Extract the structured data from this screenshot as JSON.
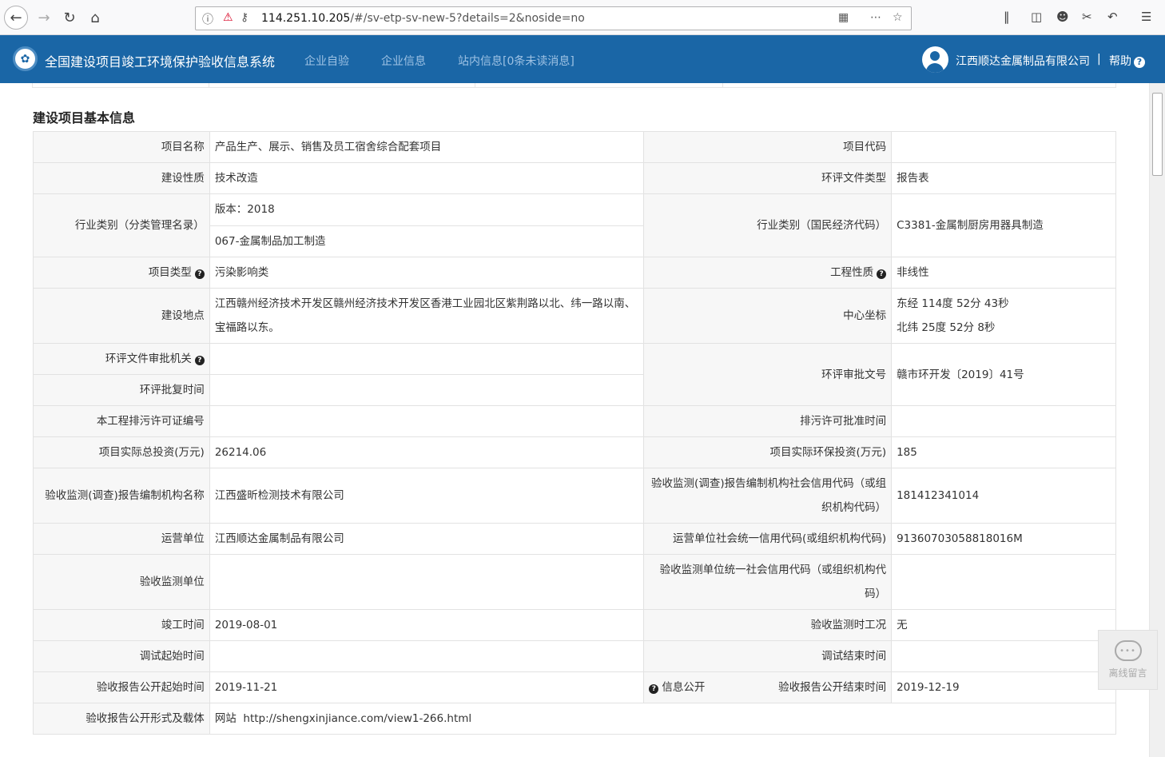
{
  "browser": {
    "url_host": "114.251.10.205",
    "url_path": "/#/sv-etp-sv-new-5?details=2&noside=no"
  },
  "header": {
    "title": "全国建设项目竣工环境保护验收信息系统",
    "nav": [
      "企业自验",
      "企业信息",
      "站内信息[0条未读消息]"
    ],
    "company": "江西顺达金属制品有限公司",
    "separator": "|",
    "help": "帮助",
    "help_icon": "?"
  },
  "section": {
    "title": "建设项目基本信息"
  },
  "rows": {
    "project_name_label": "项目名称",
    "project_name": "产品生产、展示、销售及员工宿舍综合配套项目",
    "project_code_label": "项目代码",
    "project_code": "",
    "nature_label": "建设性质",
    "nature": "技术改造",
    "eia_type_label": "环评文件类型",
    "eia_type": "报告表",
    "industry_cat_label": "行业类别（分类管理名录）",
    "industry_version": "版本：2018",
    "industry_cat": "067-金属制品加工制造",
    "industry_econ_label": "行业类别（国民经济代码）",
    "industry_econ": "C3381-金属制厨房用器具制造",
    "project_type_label": "项目类型",
    "project_type": "污染影响类",
    "eng_nature_label": "工程性质",
    "eng_nature": "非线性",
    "location_label": "建设地点",
    "location": "江西赣州经济技术开发区赣州经济技术开发区香港工业园北区紫荆路以北、纬一路以南、宝福路以东。",
    "center_coord_label": "中心坐标",
    "coord_east": "东经 114度 52分 43秒",
    "coord_north": "北纬 25度 52分 8秒",
    "eia_authority_label": "环评文件审批机关",
    "eia_authority": "",
    "eia_approval_time_label": "环评批复时间",
    "eia_approval_time": "",
    "eia_doc_no_label": "环评审批文号",
    "eia_doc_no": "赣市环开发〔2019〕41号",
    "permit_no_label": "本工程排污许可证编号",
    "permit_no": "",
    "permit_time_label": "排污许可批准时间",
    "permit_time": "",
    "invest_total_label": "项目实际总投资(万元)",
    "invest_total": "26214.06",
    "invest_env_label": "项目实际环保投资(万元)",
    "invest_env": "185",
    "report_org_label": "验收监测(调查)报告编制机构名称",
    "report_org": "江西盛昕检测技术有限公司",
    "report_org_code_label": "验收监测(调查)报告编制机构社会信用代码（或组织机构代码）",
    "report_org_code": "181412341014",
    "operator_label": "运营单位",
    "operator": "江西顺达金属制品有限公司",
    "operator_code_label": "运营单位社会统一信用代码(或组织机构代码)",
    "operator_code": "91360703058818016M",
    "monitor_unit_label": "验收监测单位",
    "monitor_unit": "",
    "monitor_unit_code_label": "验收监测单位统一社会信用代码（或组织机构代码）",
    "monitor_unit_code": "",
    "completion_label": "竣工时间",
    "completion": "2019-08-01",
    "monitor_condition_label": "验收监测时工况",
    "monitor_condition": "无",
    "debug_start_label": "调试起始时间",
    "debug_start": "",
    "debug_end_label": "调试结束时间",
    "debug_end": "",
    "public_start_label": "验收报告公开起始时间",
    "public_start": "2019-11-21",
    "info_public": "信息公开",
    "public_end_label": "验收报告公开结束时间",
    "public_end": "2019-12-19",
    "public_form_label": "验收报告公开形式及载体",
    "public_form": "网站  http://shengxinjiance.com/view1-266.html"
  },
  "widget": {
    "bubble": "•••",
    "label": "离线留言"
  }
}
